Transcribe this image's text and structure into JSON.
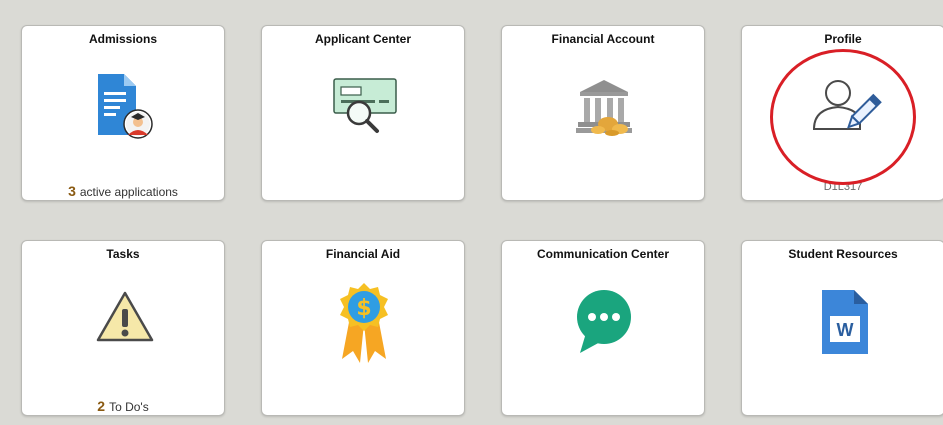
{
  "tiles": [
    {
      "title": "Admissions",
      "count": "3",
      "footer": "active applications",
      "icon": "document-applicant-icon"
    },
    {
      "title": "Applicant Center",
      "icon": "check-magnifier-icon"
    },
    {
      "title": "Financial Account",
      "icon": "bank-money-icon"
    },
    {
      "title": "Profile",
      "footer": "D1L317",
      "icon": "user-edit-icon"
    },
    {
      "title": "Tasks",
      "count": "2",
      "footer": "To Do's",
      "icon": "warning-icon"
    },
    {
      "title": "Financial Aid",
      "icon": "dollar-award-icon"
    },
    {
      "title": "Communication Center",
      "icon": "chat-bubble-icon"
    },
    {
      "title": "Student Resources",
      "icon": "word-document-icon"
    }
  ],
  "highlight": {
    "color": "#d91f26",
    "target": "Profile"
  }
}
